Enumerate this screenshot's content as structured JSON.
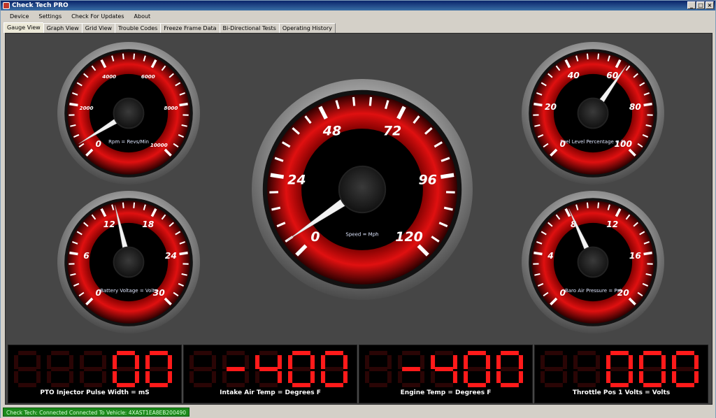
{
  "window": {
    "title": "Check Tech PRO",
    "min_glyph": "_",
    "max_glyph": "□",
    "close_glyph": "×"
  },
  "menu": [
    "Device",
    "Settings",
    "Check For Updates",
    "About"
  ],
  "tabs": [
    "Gauge View",
    "Graph View",
    "Grid View",
    "Trouble Codes",
    "Freeze Frame Data",
    "Bi-Directional Tests",
    "Operating History"
  ],
  "active_tab": 0,
  "gauges": [
    {
      "id": "rpm",
      "label": "Rpm = Revs/Min",
      "ticks": [
        "0",
        "2000",
        "4000",
        "6000",
        "8000",
        "10000"
      ],
      "fraction": 0.05
    },
    {
      "id": "battery",
      "label": "Battery Voltage = Volts",
      "ticks": [
        "0",
        "6",
        "12",
        "18",
        "24",
        "30"
      ],
      "fraction": 0.45
    },
    {
      "id": "speed",
      "label": "Speed = Mph",
      "ticks": [
        "0",
        "24",
        "48",
        "72",
        "96",
        "120"
      ],
      "fraction": 0.04
    },
    {
      "id": "fuel",
      "label": "Fuel Level Percentage = %",
      "ticks": [
        "0",
        "20",
        "40",
        "60",
        "80",
        "100"
      ],
      "fraction": 0.63
    },
    {
      "id": "baro",
      "label": "Baro Air Pressure = Psi",
      "ticks": [
        "0",
        "4",
        "8",
        "12",
        "16",
        "20"
      ],
      "fraction": 0.41
    }
  ],
  "digital": [
    {
      "label": "PTO Injector Pulse Width = mS",
      "value": "00"
    },
    {
      "label": "Intake Air Temp = Degrees F",
      "value": "-400"
    },
    {
      "label": "Engine Temp = Degrees F",
      "value": "-400"
    },
    {
      "label": "Throttle Pos 1 Volts = Volts",
      "value": "000"
    }
  ],
  "status": "Check Tech: Connected  Connected To Vehicle: 4XAST1EA8EB200490"
}
